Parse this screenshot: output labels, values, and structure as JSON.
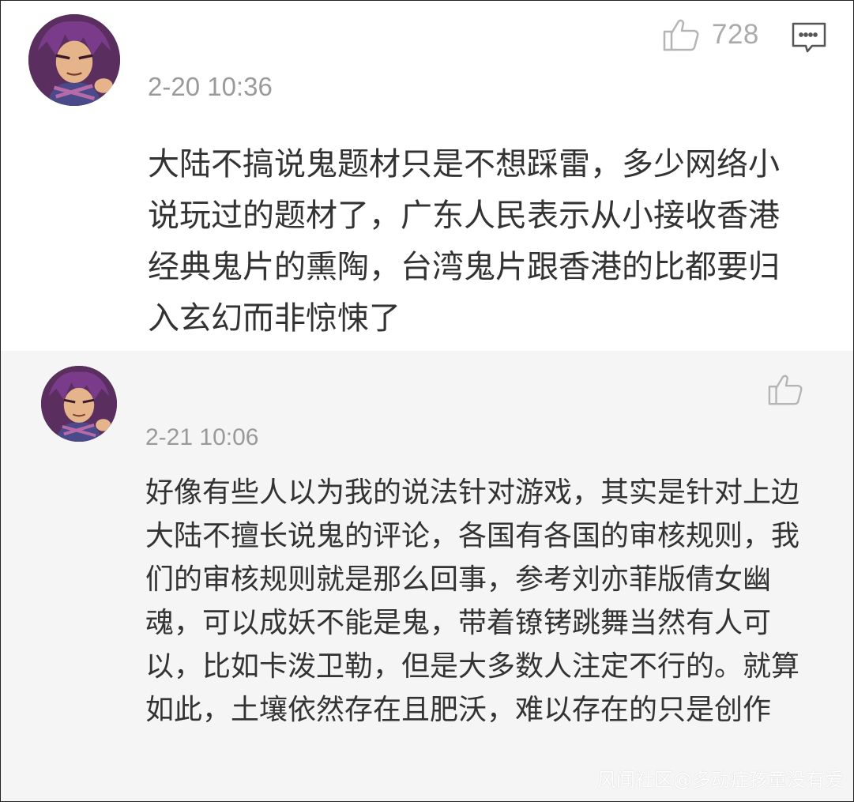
{
  "comments": [
    {
      "likes": "728",
      "time": "2-20 10:36",
      "text": "大陆不搞说鬼题材只是不想踩雷，多少网络小说玩过的题材了，广东人民表示从小接收香港经典鬼片的熏陶，台湾鬼片跟香港的比都要归入玄幻而非惊悚了",
      "icons": {
        "like": "thumbs-up-icon",
        "comment": "comment-icon"
      }
    },
    {
      "time": "2-21 10:06",
      "text": "好像有些人以为我的说法针对游戏，其实是针对上边大陆不擅长说鬼的评论，各国有各国的审核规则，我们的审核规则就是那么回事，参考刘亦菲版倩女幽魂，可以成妖不能是鬼，带着镣铐跳舞当然有人可以，比如卡泼卫勒，但是大多数人注定不行的。就算如此，土壤依然存在且肥沃，难以存在的只是创作",
      "icons": {
        "like": "thumbs-up-icon"
      }
    }
  ],
  "watermark": "风闻社区@多动症孩童没有爱",
  "colors": {
    "reply_bg": "#f5f5f5",
    "meta_gray": "#9a9a9a",
    "text": "#333333"
  }
}
